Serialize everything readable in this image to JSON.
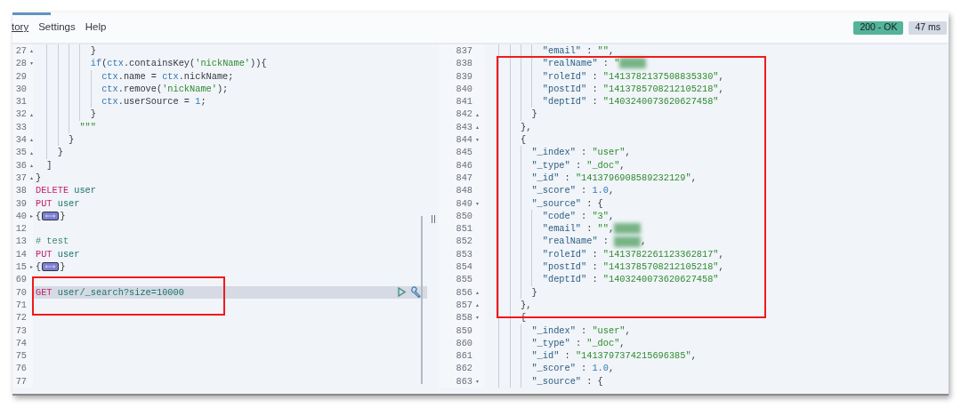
{
  "menu": [
    {
      "label": "tory",
      "underlined": true
    },
    {
      "label": "Settings",
      "underlined": false
    },
    {
      "label": "Help",
      "underlined": false
    }
  ],
  "response_status": {
    "status": "200 - OK",
    "time": "47 ms"
  },
  "request_editor": {
    "lines": [
      {
        "number": "27",
        "fold": "▴",
        "highlighted": false,
        "tokens": [
          {
            "kind": "space"
          },
          {
            "kind": "guide"
          },
          {
            "kind": "guide"
          },
          {
            "kind": "guide"
          },
          {
            "kind": "guide"
          },
          {
            "kind": "punct",
            "text": "}"
          }
        ]
      },
      {
        "number": "28",
        "fold": "▾",
        "highlighted": false,
        "tokens": [
          {
            "kind": "space"
          },
          {
            "kind": "guide"
          },
          {
            "kind": "guide"
          },
          {
            "kind": "guide"
          },
          {
            "kind": "guide"
          },
          {
            "kind": "keyword",
            "text": "if"
          },
          {
            "kind": "punct",
            "text": "("
          },
          {
            "kind": "keyword",
            "text": "ctx"
          },
          {
            "kind": "punct",
            "text": ".containsKey("
          },
          {
            "kind": "string",
            "text": "'nickName'"
          },
          {
            "kind": "punct",
            "text": ")){"
          }
        ]
      },
      {
        "number": "29",
        "highlighted": false,
        "tokens": [
          {
            "kind": "space"
          },
          {
            "kind": "guide"
          },
          {
            "kind": "guide"
          },
          {
            "kind": "guide"
          },
          {
            "kind": "guide"
          },
          {
            "kind": "guide"
          },
          {
            "kind": "keyword",
            "text": "ctx"
          },
          {
            "kind": "punct",
            "text": ".name = "
          },
          {
            "kind": "keyword",
            "text": "ctx"
          },
          {
            "kind": "punct",
            "text": ".nickName;"
          }
        ]
      },
      {
        "number": "30",
        "highlighted": false,
        "tokens": [
          {
            "kind": "space"
          },
          {
            "kind": "guide"
          },
          {
            "kind": "guide"
          },
          {
            "kind": "guide"
          },
          {
            "kind": "guide"
          },
          {
            "kind": "guide"
          },
          {
            "kind": "keyword",
            "text": "ctx"
          },
          {
            "kind": "punct",
            "text": ".remove("
          },
          {
            "kind": "string",
            "text": "'nickName'"
          },
          {
            "kind": "punct",
            "text": ");"
          }
        ]
      },
      {
        "number": "31",
        "highlighted": false,
        "tokens": [
          {
            "kind": "space"
          },
          {
            "kind": "guide"
          },
          {
            "kind": "guide"
          },
          {
            "kind": "guide"
          },
          {
            "kind": "guide"
          },
          {
            "kind": "guide"
          },
          {
            "kind": "keyword",
            "text": "ctx"
          },
          {
            "kind": "punct",
            "text": ".userSource = "
          },
          {
            "kind": "number",
            "text": "1"
          },
          {
            "kind": "punct",
            "text": ";"
          }
        ]
      },
      {
        "number": "32",
        "fold": "▴",
        "highlighted": false,
        "tokens": [
          {
            "kind": "space"
          },
          {
            "kind": "guide"
          },
          {
            "kind": "guide"
          },
          {
            "kind": "guide"
          },
          {
            "kind": "guide"
          },
          {
            "kind": "punct",
            "text": "}"
          }
        ]
      },
      {
        "number": "33",
        "highlighted": false,
        "tokens": [
          {
            "kind": "space"
          },
          {
            "kind": "guide"
          },
          {
            "kind": "guide"
          },
          {
            "kind": "guide"
          },
          {
            "kind": "string",
            "text": "\"\"\""
          }
        ]
      },
      {
        "number": "34",
        "fold": "▴",
        "highlighted": false,
        "tokens": [
          {
            "kind": "space"
          },
          {
            "kind": "guide"
          },
          {
            "kind": "guide"
          },
          {
            "kind": "punct",
            "text": "}"
          }
        ]
      },
      {
        "number": "35",
        "fold": "▴",
        "highlighted": false,
        "tokens": [
          {
            "kind": "space"
          },
          {
            "kind": "guide"
          },
          {
            "kind": "punct",
            "text": "}"
          }
        ]
      },
      {
        "number": "36",
        "fold": "▴",
        "highlighted": false,
        "tokens": [
          {
            "kind": "space"
          },
          {
            "kind": "punct",
            "text": "]"
          }
        ]
      },
      {
        "number": "37",
        "fold": "▴",
        "highlighted": false,
        "tokens": [
          {
            "kind": "punct",
            "text": "}"
          }
        ]
      },
      {
        "number": "38",
        "highlighted": false,
        "tokens": [
          {
            "kind": "method",
            "text": "DELETE"
          },
          {
            "kind": "path",
            "text": " user"
          }
        ]
      },
      {
        "number": "39",
        "highlighted": false,
        "tokens": [
          {
            "kind": "method",
            "text": "PUT"
          },
          {
            "kind": "path",
            "text": " user"
          }
        ]
      },
      {
        "number": "40",
        "fold": "▸",
        "highlighted": false,
        "tokens": [
          {
            "kind": "punct",
            "text": "{"
          },
          {
            "kind": "collapsed"
          },
          {
            "kind": "punct",
            "text": "}"
          }
        ]
      },
      {
        "number": "12",
        "highlighted": false
      },
      {
        "number": "13",
        "highlighted": false,
        "tokens": [
          {
            "kind": "comment",
            "text": "# test"
          }
        ]
      },
      {
        "number": "14",
        "highlighted": false,
        "tokens": [
          {
            "kind": "method",
            "text": "PUT"
          },
          {
            "kind": "path",
            "text": " user"
          }
        ]
      },
      {
        "number": "15",
        "fold": "▸",
        "highlighted": false,
        "tokens": [
          {
            "kind": "punct",
            "text": "{"
          },
          {
            "kind": "collapsed"
          },
          {
            "kind": "punct",
            "text": "}"
          }
        ]
      },
      {
        "number": "69",
        "highlighted": false
      },
      {
        "number": "70",
        "highlighted": true,
        "tokens": [
          {
            "kind": "method",
            "text": "GET"
          },
          {
            "kind": "path",
            "text": " user/_search?size=10000"
          }
        ]
      },
      {
        "number": "71",
        "highlighted": false
      },
      {
        "number": "72",
        "highlighted": false
      },
      {
        "number": "73",
        "highlighted": false
      },
      {
        "number": "74",
        "highlighted": false
      },
      {
        "number": "75",
        "highlighted": false
      },
      {
        "number": "76",
        "highlighted": false
      },
      {
        "number": "77",
        "highlighted": false
      }
    ]
  },
  "response_editor": {
    "lines": [
      {
        "number": "837",
        "tokens": [
          {
            "kind": "space"
          },
          {
            "kind": "guide"
          },
          {
            "kind": "guide"
          },
          {
            "kind": "guide"
          },
          {
            "kind": "guide"
          },
          {
            "kind": "key",
            "text": "\"email\""
          },
          {
            "kind": "punct",
            "text": " : "
          },
          {
            "kind": "string",
            "text": "\"\""
          },
          {
            "kind": "punct",
            "text": ","
          }
        ]
      },
      {
        "number": "838",
        "tokens": [
          {
            "kind": "space"
          },
          {
            "kind": "guide"
          },
          {
            "kind": "guide"
          },
          {
            "kind": "guide"
          },
          {
            "kind": "guide"
          },
          {
            "kind": "key",
            "text": "\"realName\""
          },
          {
            "kind": "punct",
            "text": " : "
          },
          {
            "kind": "string",
            "text": "\""
          },
          {
            "kind": "redacted"
          }
        ]
      },
      {
        "number": "839",
        "tokens": [
          {
            "kind": "space"
          },
          {
            "kind": "guide"
          },
          {
            "kind": "guide"
          },
          {
            "kind": "guide"
          },
          {
            "kind": "guide"
          },
          {
            "kind": "key",
            "text": "\"roleId\""
          },
          {
            "kind": "punct",
            "text": " : "
          },
          {
            "kind": "string",
            "text": "\"1413782137508835330\""
          },
          {
            "kind": "punct",
            "text": ","
          }
        ]
      },
      {
        "number": "840",
        "tokens": [
          {
            "kind": "space"
          },
          {
            "kind": "guide"
          },
          {
            "kind": "guide"
          },
          {
            "kind": "guide"
          },
          {
            "kind": "guide"
          },
          {
            "kind": "key",
            "text": "\"postId\""
          },
          {
            "kind": "punct",
            "text": " : "
          },
          {
            "kind": "string",
            "text": "\"1413785708212105218\""
          },
          {
            "kind": "punct",
            "text": ","
          }
        ]
      },
      {
        "number": "841",
        "tokens": [
          {
            "kind": "space"
          },
          {
            "kind": "guide"
          },
          {
            "kind": "guide"
          },
          {
            "kind": "guide"
          },
          {
            "kind": "guide"
          },
          {
            "kind": "key",
            "text": "\"deptId\""
          },
          {
            "kind": "punct",
            "text": " : "
          },
          {
            "kind": "string",
            "text": "\"1403240073620627458\""
          }
        ]
      },
      {
        "number": "842",
        "fold": "▴",
        "tokens": [
          {
            "kind": "space"
          },
          {
            "kind": "guide"
          },
          {
            "kind": "guide"
          },
          {
            "kind": "guide"
          },
          {
            "kind": "punct",
            "text": "}"
          }
        ]
      },
      {
        "number": "843",
        "fold": "▴",
        "tokens": [
          {
            "kind": "space"
          },
          {
            "kind": "guide"
          },
          {
            "kind": "guide"
          },
          {
            "kind": "punct",
            "text": "},"
          }
        ]
      },
      {
        "number": "844",
        "fold": "▾",
        "tokens": [
          {
            "kind": "space"
          },
          {
            "kind": "guide"
          },
          {
            "kind": "guide"
          },
          {
            "kind": "punct",
            "text": "{"
          }
        ]
      },
      {
        "number": "845",
        "tokens": [
          {
            "kind": "space"
          },
          {
            "kind": "guide"
          },
          {
            "kind": "guide"
          },
          {
            "kind": "guide"
          },
          {
            "kind": "key",
            "text": "\"_index\""
          },
          {
            "kind": "punct",
            "text": " : "
          },
          {
            "kind": "string",
            "text": "\"user\""
          },
          {
            "kind": "punct",
            "text": ","
          }
        ]
      },
      {
        "number": "846",
        "tokens": [
          {
            "kind": "space"
          },
          {
            "kind": "guide"
          },
          {
            "kind": "guide"
          },
          {
            "kind": "guide"
          },
          {
            "kind": "key",
            "text": "\"_type\""
          },
          {
            "kind": "punct",
            "text": " : "
          },
          {
            "kind": "string",
            "text": "\"_doc\""
          },
          {
            "kind": "punct",
            "text": ","
          }
        ]
      },
      {
        "number": "847",
        "tokens": [
          {
            "kind": "space"
          },
          {
            "kind": "guide"
          },
          {
            "kind": "guide"
          },
          {
            "kind": "guide"
          },
          {
            "kind": "key",
            "text": "\"_id\""
          },
          {
            "kind": "punct",
            "text": " : "
          },
          {
            "kind": "string",
            "text": "\"1413796908589232129\""
          },
          {
            "kind": "punct",
            "text": ","
          }
        ]
      },
      {
        "number": "848",
        "tokens": [
          {
            "kind": "space"
          },
          {
            "kind": "guide"
          },
          {
            "kind": "guide"
          },
          {
            "kind": "guide"
          },
          {
            "kind": "key",
            "text": "\"_score\""
          },
          {
            "kind": "punct",
            "text": " : "
          },
          {
            "kind": "number",
            "text": "1.0"
          },
          {
            "kind": "punct",
            "text": ","
          }
        ]
      },
      {
        "number": "849",
        "fold": "▾",
        "tokens": [
          {
            "kind": "space"
          },
          {
            "kind": "guide"
          },
          {
            "kind": "guide"
          },
          {
            "kind": "guide"
          },
          {
            "kind": "key",
            "text": "\"_source\""
          },
          {
            "kind": "punct",
            "text": " : {"
          }
        ]
      },
      {
        "number": "850",
        "tokens": [
          {
            "kind": "space"
          },
          {
            "kind": "guide"
          },
          {
            "kind": "guide"
          },
          {
            "kind": "guide"
          },
          {
            "kind": "guide"
          },
          {
            "kind": "key",
            "text": "\"code\""
          },
          {
            "kind": "punct",
            "text": " : "
          },
          {
            "kind": "string",
            "text": "\"3\""
          },
          {
            "kind": "punct",
            "text": ","
          }
        ]
      },
      {
        "number": "851",
        "tokens": [
          {
            "kind": "space"
          },
          {
            "kind": "guide"
          },
          {
            "kind": "guide"
          },
          {
            "kind": "guide"
          },
          {
            "kind": "guide"
          },
          {
            "kind": "key",
            "text": "\"email\""
          },
          {
            "kind": "punct",
            "text": " : "
          },
          {
            "kind": "string",
            "text": "\"\""
          },
          {
            "kind": "punct",
            "text": ","
          },
          {
            "kind": "redacted"
          }
        ]
      },
      {
        "number": "852",
        "tokens": [
          {
            "kind": "space"
          },
          {
            "kind": "guide"
          },
          {
            "kind": "guide"
          },
          {
            "kind": "guide"
          },
          {
            "kind": "guide"
          },
          {
            "kind": "key",
            "text": "\"realName\""
          },
          {
            "kind": "punct",
            "text": " : "
          },
          {
            "kind": "redacted"
          },
          {
            "kind": "punct",
            "text": ","
          }
        ]
      },
      {
        "number": "853",
        "tokens": [
          {
            "kind": "space"
          },
          {
            "kind": "guide"
          },
          {
            "kind": "guide"
          },
          {
            "kind": "guide"
          },
          {
            "kind": "guide"
          },
          {
            "kind": "key",
            "text": "\"roleId\""
          },
          {
            "kind": "punct",
            "text": " : "
          },
          {
            "kind": "string",
            "text": "\"1413782261123362817\""
          },
          {
            "kind": "punct",
            "text": ","
          }
        ]
      },
      {
        "number": "854",
        "tokens": [
          {
            "kind": "space"
          },
          {
            "kind": "guide"
          },
          {
            "kind": "guide"
          },
          {
            "kind": "guide"
          },
          {
            "kind": "guide"
          },
          {
            "kind": "key",
            "text": "\"postId\""
          },
          {
            "kind": "punct",
            "text": " : "
          },
          {
            "kind": "string",
            "text": "\"1413785708212105218\""
          },
          {
            "kind": "punct",
            "text": ","
          }
        ]
      },
      {
        "number": "855",
        "tokens": [
          {
            "kind": "space"
          },
          {
            "kind": "guide"
          },
          {
            "kind": "guide"
          },
          {
            "kind": "guide"
          },
          {
            "kind": "guide"
          },
          {
            "kind": "key",
            "text": "\"deptId\""
          },
          {
            "kind": "punct",
            "text": " : "
          },
          {
            "kind": "string",
            "text": "\"1403240073620627458\""
          }
        ]
      },
      {
        "number": "856",
        "fold": "▴",
        "tokens": [
          {
            "kind": "space"
          },
          {
            "kind": "guide"
          },
          {
            "kind": "guide"
          },
          {
            "kind": "guide"
          },
          {
            "kind": "punct",
            "text": "}"
          }
        ]
      },
      {
        "number": "857",
        "fold": "▴",
        "tokens": [
          {
            "kind": "space"
          },
          {
            "kind": "guide"
          },
          {
            "kind": "guide"
          },
          {
            "kind": "punct",
            "text": "},"
          }
        ]
      },
      {
        "number": "858",
        "fold": "▾",
        "tokens": [
          {
            "kind": "space"
          },
          {
            "kind": "guide"
          },
          {
            "kind": "guide"
          },
          {
            "kind": "punct",
            "text": "{"
          }
        ]
      },
      {
        "number": "859",
        "tokens": [
          {
            "kind": "space"
          },
          {
            "kind": "guide"
          },
          {
            "kind": "guide"
          },
          {
            "kind": "guide"
          },
          {
            "kind": "key",
            "text": "\"_index\""
          },
          {
            "kind": "punct",
            "text": " : "
          },
          {
            "kind": "string",
            "text": "\"user\""
          },
          {
            "kind": "punct",
            "text": ","
          }
        ]
      },
      {
        "number": "860",
        "tokens": [
          {
            "kind": "space"
          },
          {
            "kind": "guide"
          },
          {
            "kind": "guide"
          },
          {
            "kind": "guide"
          },
          {
            "kind": "key",
            "text": "\"_type\""
          },
          {
            "kind": "punct",
            "text": " : "
          },
          {
            "kind": "string",
            "text": "\"_doc\""
          },
          {
            "kind": "punct",
            "text": ","
          }
        ]
      },
      {
        "number": "861",
        "tokens": [
          {
            "kind": "space"
          },
          {
            "kind": "guide"
          },
          {
            "kind": "guide"
          },
          {
            "kind": "guide"
          },
          {
            "kind": "key",
            "text": "\"_id\""
          },
          {
            "kind": "punct",
            "text": " : "
          },
          {
            "kind": "string",
            "text": "\"1413797374215696385\""
          },
          {
            "kind": "punct",
            "text": ","
          }
        ]
      },
      {
        "number": "862",
        "tokens": [
          {
            "kind": "space"
          },
          {
            "kind": "guide"
          },
          {
            "kind": "guide"
          },
          {
            "kind": "guide"
          },
          {
            "kind": "key",
            "text": "\"_score\""
          },
          {
            "kind": "punct",
            "text": " : "
          },
          {
            "kind": "number",
            "text": "1.0"
          },
          {
            "kind": "punct",
            "text": ","
          }
        ]
      },
      {
        "number": "863",
        "fold": "▾",
        "tokens": [
          {
            "kind": "space"
          },
          {
            "kind": "guide"
          },
          {
            "kind": "guide"
          },
          {
            "kind": "guide"
          },
          {
            "kind": "key",
            "text": "\"_source\""
          },
          {
            "kind": "punct",
            "text": " : {"
          }
        ]
      }
    ]
  }
}
